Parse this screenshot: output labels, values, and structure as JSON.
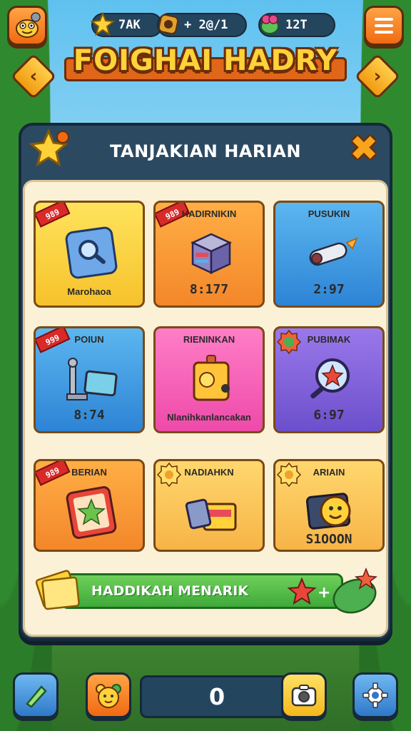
{
  "header": {
    "resources": [
      {
        "icon": "star-icon",
        "value": "7AK"
      },
      {
        "icon": "coin-icon",
        "value": "+ 2@/1"
      },
      {
        "icon": "gem-creature-icon",
        "value": "12T"
      }
    ],
    "title": "FOIGHAI HADRY"
  },
  "panel": {
    "title": "TANJAKIAN HARIAN"
  },
  "cards": [
    {
      "name": "",
      "footer": "Marohaoa",
      "color": "yellow",
      "tag": "989",
      "icon": "magnifier-tile-icon"
    },
    {
      "name": "HADIRNIKIN",
      "footer": "8:177",
      "color": "orange",
      "tag": "989",
      "icon": "cube-building-icon"
    },
    {
      "name": "PUSUKIN",
      "footer": "2:97",
      "color": "blue",
      "tag": "",
      "icon": "rocket-icon"
    },
    {
      "name": "POIUN",
      "footer": "8:74",
      "color": "blue",
      "tag": "999",
      "icon": "screen-stand-icon"
    },
    {
      "name": "RIENINKAN",
      "footer": "Nlanihkanlancakan",
      "color": "pink",
      "tag": "",
      "icon": "sun-box-icon"
    },
    {
      "name": "PUBIMAK",
      "footer": "6:97",
      "color": "purple",
      "tag": "",
      "icon": "star-magnifier-icon",
      "seal": true
    },
    {
      "name": "BERIAN",
      "footer": "",
      "color": "orange",
      "tag": "989",
      "icon": "star-card-icon"
    },
    {
      "name": "NADIAHKN",
      "footer": "",
      "color": "peach",
      "tag": "",
      "icon": "gift-box-icon",
      "seal": true
    },
    {
      "name": "ARIAIN",
      "footer": "S1OOON",
      "color": "peach",
      "tag": "",
      "icon": "emoji-card-icon",
      "seal": true
    }
  ],
  "reward": {
    "label": "HADDIKAH MENARIK"
  },
  "bottom": {
    "counter": "0"
  },
  "colors": {
    "panel": "#2b4a62",
    "panelBody": "#fbf1d6",
    "ribbon": "#e0661a",
    "titleText": "#ffd23a",
    "rewardGreen": "#3fa93a"
  }
}
